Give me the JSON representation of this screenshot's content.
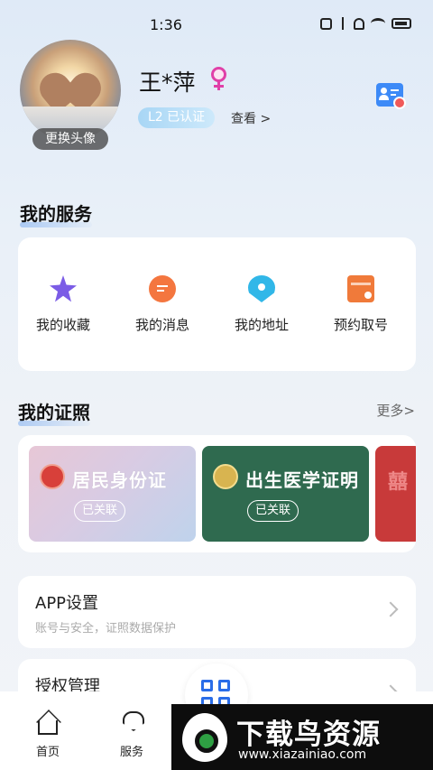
{
  "status_bar": {
    "time": "1:36"
  },
  "profile": {
    "avatar_caption": "更换头像",
    "name": "王*萍",
    "certification": "L2 已认证",
    "view_link": "查看 >"
  },
  "services": {
    "title": "我的服务",
    "items": [
      {
        "label": "我的收藏",
        "icon": "star-icon",
        "color": "#7b5ce6"
      },
      {
        "label": "我的消息",
        "icon": "message-icon",
        "color": "#f4763f"
      },
      {
        "label": "我的地址",
        "icon": "location-icon",
        "color": "#31b7e8"
      },
      {
        "label": "预约取号",
        "icon": "calendar-icon",
        "color": "#f07a3a"
      }
    ]
  },
  "licenses": {
    "title": "我的证照",
    "more": "更多>",
    "cards": [
      {
        "name": "居民身份证",
        "status": "已关联"
      },
      {
        "name": "出生医学证明",
        "status": "已关联"
      }
    ]
  },
  "settings": [
    {
      "title": "APP设置",
      "subtitle": "账号与安全，证照数据保护"
    },
    {
      "title": "授权管理",
      "subtitle": ""
    }
  ],
  "bottom_nav": {
    "items": [
      {
        "label": "首页",
        "icon": "home-icon"
      },
      {
        "label": "服务",
        "icon": "service-heart-icon"
      }
    ],
    "center_icon": "qr-code-icon"
  },
  "watermark": {
    "title": "下载鸟资源",
    "url": "www.xiazainiao.com"
  },
  "colors": {
    "accent": "#2a6de8",
    "female": "#e040a8",
    "birth_cert": "#2f6a4f"
  }
}
